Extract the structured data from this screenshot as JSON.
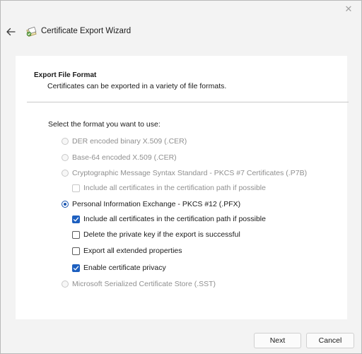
{
  "window": {
    "title": "Certificate Export Wizard",
    "close_glyph": "✕"
  },
  "header": {
    "section_title": "Export File Format",
    "section_subtitle": "Certificates can be exported in a variety of file formats."
  },
  "form": {
    "prompt": "Select the format you want to use:",
    "formats": [
      {
        "label": "DER encoded binary X.509 (.CER)",
        "selected": false,
        "enabled": false
      },
      {
        "label": "Base-64 encoded X.509 (.CER)",
        "selected": false,
        "enabled": false
      },
      {
        "label": "Cryptographic Message Syntax Standard - PKCS #7 Certificates (.P7B)",
        "selected": false,
        "enabled": false
      },
      {
        "label": "Personal Information Exchange - PKCS #12 (.PFX)",
        "selected": true,
        "enabled": true
      },
      {
        "label": "Microsoft Serialized Certificate Store (.SST)",
        "selected": false,
        "enabled": false
      }
    ],
    "p7b_options": [
      {
        "label": "Include all certificates in the certification path if possible",
        "checked": false,
        "enabled": false
      }
    ],
    "pfx_options": [
      {
        "label": "Include all certificates in the certification path if possible",
        "checked": true,
        "enabled": true
      },
      {
        "label": "Delete the private key if the export is successful",
        "checked": false,
        "enabled": true
      },
      {
        "label": "Export all extended properties",
        "checked": false,
        "enabled": true
      },
      {
        "label": "Enable certificate privacy",
        "checked": true,
        "enabled": true
      }
    ]
  },
  "footer": {
    "next_label": "Next",
    "cancel_label": "Cancel"
  },
  "colors": {
    "accent": "#1d5fbf",
    "disabled_text": "#8f8f8f",
    "window_bg": "#f3f3f3"
  },
  "icons": {
    "back": "arrow-left-icon",
    "wizard": "certificate-icon",
    "close": "close-icon",
    "check": "checkmark-icon"
  }
}
